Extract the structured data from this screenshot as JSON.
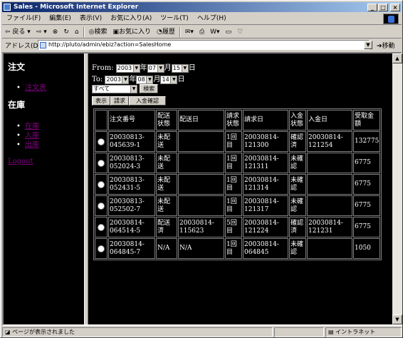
{
  "window": {
    "title": "Sales - Microsoft Internet Explorer"
  },
  "menu": [
    "ファイル(F)",
    "編集(E)",
    "表示(V)",
    "お気に入り(A)",
    "ツール(T)",
    "ヘルプ(H)"
  ],
  "toolbar": {
    "back": "戻る",
    "search": "検索",
    "favorites": "お気に入り",
    "history": "履歴"
  },
  "address": {
    "label": "アドレス(D)",
    "url": "http://pluto/admin/ebiz?action=SalesHome",
    "go": "移動"
  },
  "nav": {
    "order_heading": "注文",
    "order_links": [
      "注文表"
    ],
    "stock_heading": "在庫",
    "stock_links": [
      "在庫",
      "入庫",
      "出庫"
    ],
    "logout": "Logout"
  },
  "filter": {
    "from_label": "From:",
    "to_label": "To:",
    "from_year": "2003",
    "from_month": "07",
    "from_day": "15",
    "to_year": "2003",
    "to_month": "08",
    "to_day": "14",
    "year_unit": "年",
    "month_unit": "月",
    "day_unit": "日",
    "status_value": "すべて",
    "search_button": "検索"
  },
  "tabs": [
    "表示",
    "請求",
    "入金確認"
  ],
  "table": {
    "headers": [
      "注文番号",
      "配送状態",
      "配送日",
      "請求状態",
      "請求日",
      "入金状態",
      "入金日",
      "受取金額"
    ],
    "rows": [
      [
        "20030813-045639-1",
        "未配送",
        "",
        "1回目",
        "20030814-121300",
        "確認済",
        "20030814-121254",
        "132775"
      ],
      [
        "20030813-052024-3",
        "未配送",
        "",
        "1回目",
        "20030814-121311",
        "未確認",
        "",
        "6775"
      ],
      [
        "20030813-052431-5",
        "未配送",
        "",
        "1回目",
        "20030814-121314",
        "未確認",
        "",
        "6775"
      ],
      [
        "20030813-052502-7",
        "未配送",
        "",
        "1回目",
        "20030814-121317",
        "未確認",
        "",
        "6775"
      ],
      [
        "20030814-064514-5",
        "配送済",
        "20030814-115623",
        "5回目",
        "20030814-121224",
        "確認済",
        "20030814-121231",
        "6775"
      ],
      [
        "20030814-064845-7",
        "N/A",
        "N/A",
        "1回目",
        "20030814-064845",
        "未確認",
        "",
        "1050"
      ]
    ]
  },
  "status": {
    "text": "ページが表示されました",
    "zone": "イントラネット"
  }
}
